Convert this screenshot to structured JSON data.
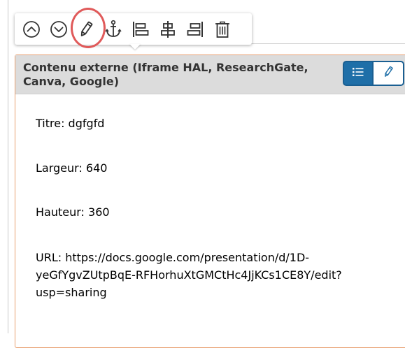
{
  "toolbar": {
    "buttons": [
      {
        "name": "move-up",
        "icon": "chevron-up-circle-icon"
      },
      {
        "name": "move-down",
        "icon": "chevron-down-circle-icon"
      },
      {
        "name": "edit",
        "icon": "pencil-icon",
        "highlighted": true
      },
      {
        "name": "anchor",
        "icon": "anchor-icon"
      },
      {
        "name": "align-left",
        "icon": "align-left-icon"
      },
      {
        "name": "align-center",
        "icon": "align-center-icon"
      },
      {
        "name": "align-right",
        "icon": "align-right-icon"
      },
      {
        "name": "delete",
        "icon": "trash-icon"
      }
    ]
  },
  "block": {
    "title": "Contenu externe (Iframe HAL, ResearchGate, Canva, Google)",
    "actions": {
      "list_icon": "list-icon",
      "edit_icon": "pencil-icon"
    },
    "fields": {
      "title": "Titre: dgfgfd",
      "width": "Largeur: 640",
      "height": "Hauteur: 360",
      "url": "URL: https://docs.google.com/presentation/d/1D-yeGfYgvZUtpBqE-RFHorhuXtGMCtHc4JjKCs1CE8Y/edit?usp=sharing"
    }
  },
  "colors": {
    "accent": "#1f6fa8",
    "block_border": "#e8a070",
    "header_bg": "#dcdcdc",
    "highlight": "#e05a5a"
  }
}
